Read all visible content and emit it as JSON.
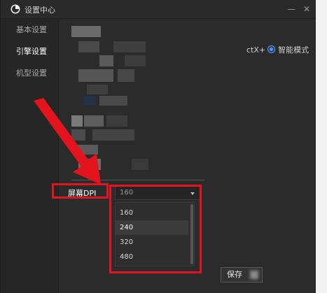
{
  "window": {
    "title": "设置中心",
    "minimize_glyph": "—",
    "close_glyph": "✕"
  },
  "sidebar": {
    "items": [
      {
        "label": "基本设置",
        "active": false
      },
      {
        "label": "引擎设置",
        "active": true
      },
      {
        "label": "机型设置",
        "active": false
      }
    ]
  },
  "engine": {
    "mode_label_prefix": "ctX+",
    "mode_label": "智能模式",
    "dpi_label": "屏幕DPI",
    "dpi_selected": "160",
    "dpi_options": [
      "160",
      "240",
      "320",
      "480"
    ],
    "dpi_highlighted": "240"
  },
  "footer": {
    "save_label": "保存"
  },
  "colors": {
    "window_bg": "#2b2b2b",
    "sidebar_bg": "#262626",
    "annotation_red": "#e3141e",
    "radio_blue": "#4b8cff"
  },
  "icons": {
    "app_logo": "app-logo-icon",
    "dropdown": "chevron-down-icon",
    "annotation": "red-arrow-icon"
  }
}
